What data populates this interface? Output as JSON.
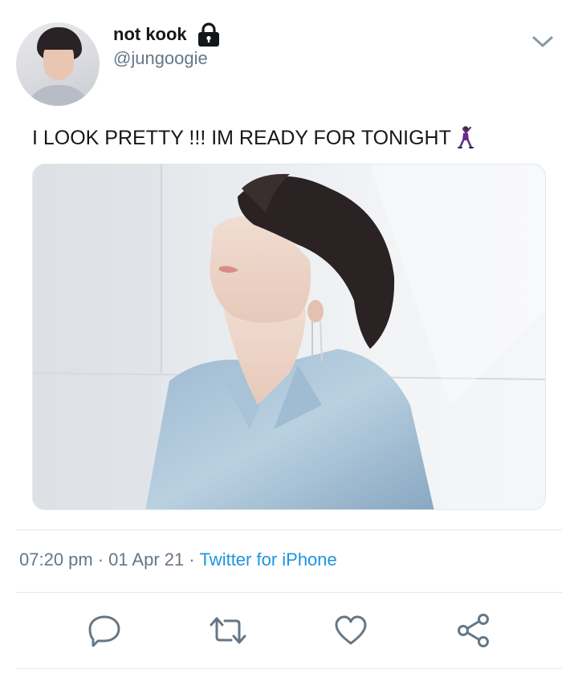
{
  "author": {
    "display_name": "not kook",
    "handle": "@jungoogie",
    "protected": true
  },
  "tweet": {
    "text": "I LOOK PRETTY !!! IM READY FOR TONIGHT",
    "emoji": "dancer"
  },
  "meta": {
    "time": "07:20 pm",
    "date": "01 Apr 21",
    "separator": "·",
    "source": "Twitter for iPhone"
  },
  "icons": {
    "lock": "lock-icon",
    "chevron": "chevron-down-icon",
    "reply": "reply-icon",
    "retweet": "retweet-icon",
    "like": "heart-icon",
    "share": "share-icon"
  },
  "colors": {
    "text": "#14171a",
    "secondary": "#657786",
    "link": "#1b95e0",
    "icon": "#657786",
    "divider": "#e1e8ed"
  }
}
